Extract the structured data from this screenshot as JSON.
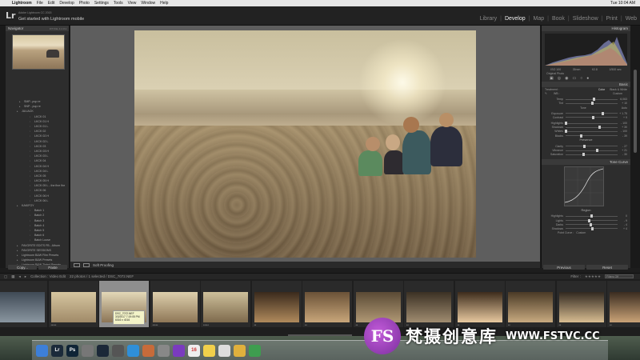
{
  "menubar": {
    "app": "Lightroom",
    "items": [
      "File",
      "Edit",
      "Develop",
      "Photo",
      "Settings",
      "Tools",
      "View",
      "Window",
      "Help"
    ],
    "window_title": "Lightroom Catalog-2.lrcat - Adobe Photoshop Lightroom - Develop",
    "status": "Tue 10:04 AM"
  },
  "identity": {
    "logo": "Lr",
    "small": "Adobe Lightroom CC 2015",
    "main": "Get started with Lightroom mobile"
  },
  "modules": [
    "Library",
    "Develop",
    "Map",
    "Book",
    "Slideshow",
    "Print",
    "Web"
  ],
  "modules_active": "Develop",
  "left_panel": {
    "navigator_title": "Navigator",
    "navigator_controls": "FIT FILL 1:1 3:1",
    "folders": [
      {
        "label": "SMP...pup re",
        "level": 1
      },
      {
        "label": "SNP - pup re",
        "level": 1
      },
      {
        "label": "JULIACK",
        "level": 0
      },
      {
        "label": "LKCK 01",
        "level": 2
      },
      {
        "label": "LKCK 01 H",
        "level": 2
      },
      {
        "label": "LKCK 01 L",
        "level": 2
      },
      {
        "label": "LKCK 02",
        "level": 2
      },
      {
        "label": "LKCK 02 H",
        "level": 2
      },
      {
        "label": "LKCK 02 L",
        "level": 2
      },
      {
        "label": "LKCK 03",
        "level": 2
      },
      {
        "label": "LKCK 03 H",
        "level": 2
      },
      {
        "label": "LKCK 03 L",
        "level": 2
      },
      {
        "label": "LKCK 04",
        "level": 2
      },
      {
        "label": "LKCK 04 H",
        "level": 2
      },
      {
        "label": "LKCK 04 L",
        "level": 2
      },
      {
        "label": "LKCK 05",
        "level": 2
      },
      {
        "label": "LKCK 05 H",
        "level": 2
      },
      {
        "label": "LKCK 05 L - the fine fire",
        "level": 2
      },
      {
        "label": "LKCK 06",
        "level": 2
      },
      {
        "label": "LKCK 06 H",
        "level": 2
      },
      {
        "label": "LKCK 06 L",
        "level": 2
      },
      {
        "label": "KAKIFOY",
        "level": 0
      },
      {
        "label": "Batch 1",
        "level": 2
      },
      {
        "label": "Batch 2",
        "level": 2
      },
      {
        "label": "Batch 3",
        "level": 2
      },
      {
        "label": "Batch 4",
        "level": 2
      },
      {
        "label": "Batch 5",
        "level": 2
      },
      {
        "label": "Batch 6",
        "level": 2
      },
      {
        "label": "Batch Loose",
        "level": 2
      },
      {
        "label": "FAVORITE EDITS FB - Album",
        "level": 0
      },
      {
        "label": "FAVORITE SESSIONS",
        "level": 0
      },
      {
        "label": "Lightroom B&W Film Presets",
        "level": 0
      },
      {
        "label": "Lightroom B&W Presets",
        "level": 0
      },
      {
        "label": "Lightroom B&W Tinted Presets",
        "level": 0
      }
    ],
    "copy_label": "Copy...",
    "paste_label": "Paste"
  },
  "toolbar": {
    "soft_proofing": "Soft Proofing"
  },
  "right_panel": {
    "histogram_title": "Histogram",
    "readouts": [
      "ISO 100",
      "35mm",
      "f/2.8",
      "1/500 sec"
    ],
    "original_photo": "Original Photo",
    "basic_title": "Basic",
    "treatment_label": "Treatment :",
    "treatment_color": "Color",
    "treatment_bw": "Black & White",
    "wb_label": "WB :",
    "wb_value": "Custom",
    "rows1": [
      {
        "label": "Temp",
        "value": "6,063",
        "pos": 0.55
      },
      {
        "label": "Tint",
        "value": "+ 10",
        "pos": 0.52
      }
    ],
    "tone_label": "Tone",
    "tone_auto": "Auto",
    "rows2": [
      {
        "label": "Exposure",
        "value": "+ 1.75",
        "pos": 0.72
      },
      {
        "label": "Contrast",
        "value": "+ 9",
        "pos": 0.53
      }
    ],
    "rows3": [
      {
        "label": "Highlights",
        "value": "- 100",
        "pos": 0.0
      },
      {
        "label": "Shadows",
        "value": "+ 30",
        "pos": 0.65
      },
      {
        "label": "Whites",
        "value": "- 100",
        "pos": 0.0
      },
      {
        "label": "Blacks",
        "value": "- 39",
        "pos": 0.3
      }
    ],
    "presence_label": "Presence",
    "rows4": [
      {
        "label": "Clarity",
        "value": "- 27",
        "pos": 0.36
      },
      {
        "label": "Vibrance",
        "value": "+ 21",
        "pos": 0.6
      },
      {
        "label": "Saturation",
        "value": "- 30",
        "pos": 0.35
      }
    ],
    "tone_curve_title": "Tone Curve",
    "region_label": "Region",
    "rows5": [
      {
        "label": "Highlights",
        "value": "0",
        "pos": 0.5
      },
      {
        "label": "Lights",
        "value": "- 9",
        "pos": 0.45
      },
      {
        "label": "Darks",
        "value": "- 4",
        "pos": 0.48
      },
      {
        "label": "Shadows",
        "value": "+ 4",
        "pos": 0.52
      }
    ],
    "point_curve_label": "Point Curve :",
    "point_curve_value": "Custom",
    "previous_label": "Previous",
    "reset_label": "Reset"
  },
  "filmstrip": {
    "source": "Collection : Video Edit",
    "count": "22 photos / 1 selected / DSC_7072.NEF",
    "filter_label": "Filter :",
    "filter_value": "Filters Off",
    "tooltip": [
      "DSC_7072.NEF",
      "3/3/2017 7:19:05 PM",
      "6016 x 4016"
    ],
    "frames": [
      {
        "stars": "",
        "colors": [
          "#3f4a55",
          "#8a96a0"
        ]
      },
      {
        "stars": "*****",
        "colors": [
          "#d6c6a0",
          "#a08a68"
        ]
      },
      {
        "stars": "",
        "colors": [
          "#e3d8b8",
          "#8c7556"
        ]
      },
      {
        "stars": "*****",
        "colors": [
          "#ddcfac",
          "#8f7757"
        ]
      },
      {
        "stars": "*****",
        "colors": [
          "#cdbf9a",
          "#7e6a4d"
        ]
      },
      {
        "stars": "**",
        "colors": [
          "#3a2a1c",
          "#b08a5c"
        ]
      },
      {
        "stars": "**",
        "colors": [
          "#6b5237",
          "#c8a67a"
        ]
      },
      {
        "stars": "**",
        "colors": [
          "#5a4a35",
          "#b09874"
        ]
      },
      {
        "stars": "**",
        "colors": [
          "#3b3124",
          "#a08c70"
        ]
      },
      {
        "stars": "**",
        "colors": [
          "#3d2c1c",
          "#e8c9a0"
        ]
      },
      {
        "stars": "**",
        "colors": [
          "#4a3a26",
          "#c8aa80"
        ]
      },
      {
        "stars": "**",
        "colors": [
          "#312820",
          "#d8bd92"
        ]
      },
      {
        "stars": "**",
        "colors": [
          "#3a2c20",
          "#caa377"
        ]
      }
    ]
  },
  "dock": {
    "icons": [
      {
        "name": "finder-icon",
        "label": "",
        "color": "#3d7fd8"
      },
      {
        "name": "lightroom-icon",
        "label": "Lr",
        "color": "#1b2a3a"
      },
      {
        "name": "photoshop-icon",
        "label": "Ps",
        "color": "#0f2436"
      },
      {
        "name": "launchpad-icon",
        "label": "",
        "color": "#777"
      },
      {
        "name": "steam-icon",
        "label": "",
        "color": "#1b2838"
      },
      {
        "name": "tool-icon",
        "label": "",
        "color": "#555"
      },
      {
        "name": "safari-icon",
        "label": "",
        "color": "#2f8fd8"
      },
      {
        "name": "stamp-icon",
        "label": "",
        "color": "#c76b3a"
      },
      {
        "name": "music-icon",
        "label": "",
        "color": "#888"
      },
      {
        "name": "imovie-icon",
        "label": "",
        "color": "#7a3bbf"
      },
      {
        "name": "calendar-icon",
        "label": "16",
        "color": "#eee"
      },
      {
        "name": "notes-icon",
        "label": "",
        "color": "#f2d04b"
      },
      {
        "name": "reminders-icon",
        "label": "",
        "color": "#ddd"
      },
      {
        "name": "photos-icon",
        "label": "",
        "color": "#e0b03d"
      },
      {
        "name": "chrome-icon",
        "label": "",
        "color": "#3e9d4f"
      }
    ]
  },
  "watermark": {
    "logo": "FS",
    "text": "梵摄创意库",
    "url": "WWW.FSTVC.CC"
  }
}
